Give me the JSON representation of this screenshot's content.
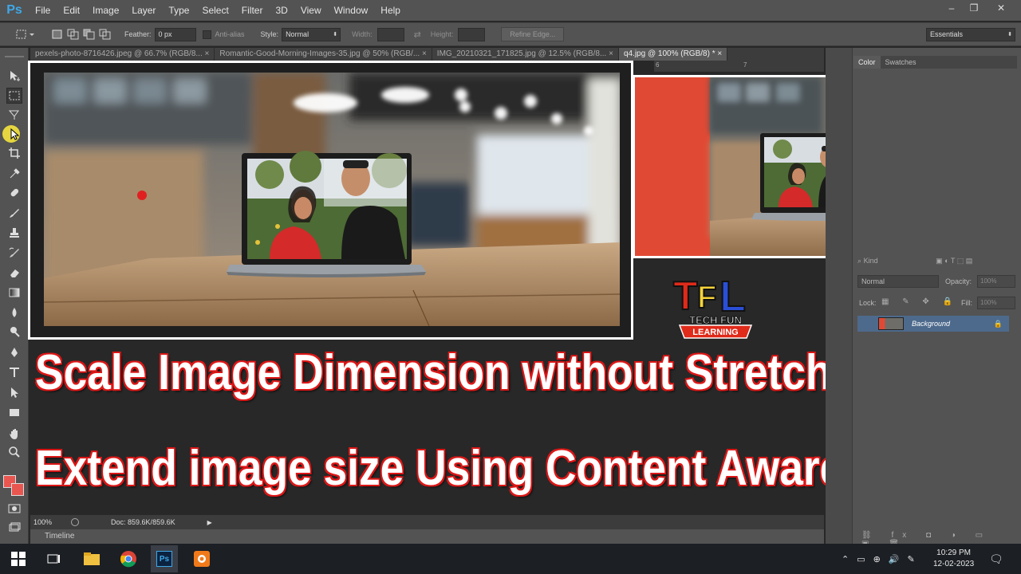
{
  "app": {
    "logo": "Ps"
  },
  "menu": [
    "File",
    "Edit",
    "Image",
    "Layer",
    "Type",
    "Select",
    "Filter",
    "3D",
    "View",
    "Window",
    "Help"
  ],
  "window_controls": {
    "minimize": "–",
    "restore": "❐",
    "close": "✕"
  },
  "options": {
    "feather_label": "Feather:",
    "feather_value": "0 px",
    "antialias_label": "Anti-alias",
    "style_label": "Style:",
    "style_value": "Normal",
    "width_label": "Width:",
    "height_label": "Height:",
    "refine_edge": "Refine Edge...",
    "workspace_value": "Essentials"
  },
  "tabs": [
    {
      "label": "pexels-photo-8716426.jpeg @ 66.7% (RGB/8...",
      "close": "×",
      "active": false
    },
    {
      "label": "Romantic-Good-Morning-Images-35.jpg @ 50% (RGB/...",
      "close": "×",
      "active": false
    },
    {
      "label": "IMG_20210321_171825.jpg @ 12.5% (RGB/8...",
      "close": "×",
      "active": false
    },
    {
      "label": "q4.jpg @ 100% (RGB/8) *",
      "close": "×",
      "active": true
    }
  ],
  "ruler_marks": [
    "6",
    "7"
  ],
  "headline": {
    "line1": "Scale Image Dimension without Stretching",
    "line2": "Extend image size Using Content Aware"
  },
  "logo": {
    "letters": "TFL",
    "line1": "TECH FUN",
    "line2": "LEARNING"
  },
  "status": {
    "zoom": "100%",
    "doc": "Doc: 859.6K/859.6K"
  },
  "timeline_label": "Timeline",
  "panels": {
    "color_tab": "Color",
    "swatches_tab": "Swatches",
    "kind_label": "Kind",
    "blend_mode": "Normal",
    "opacity_label": "Opacity:",
    "opacity_value": "100%",
    "lock_label": "Lock:",
    "fill_label": "Fill:",
    "fill_value": "100%",
    "layer_name": "Background"
  },
  "taskbar": {
    "time": "10:29 PM",
    "date": "12-02-2023"
  },
  "colors": {
    "accent_red": "#e01a1a",
    "ps_blue": "#3fa8e8",
    "panel_grey": "#535353",
    "fg_swatch": "#e8564f"
  }
}
